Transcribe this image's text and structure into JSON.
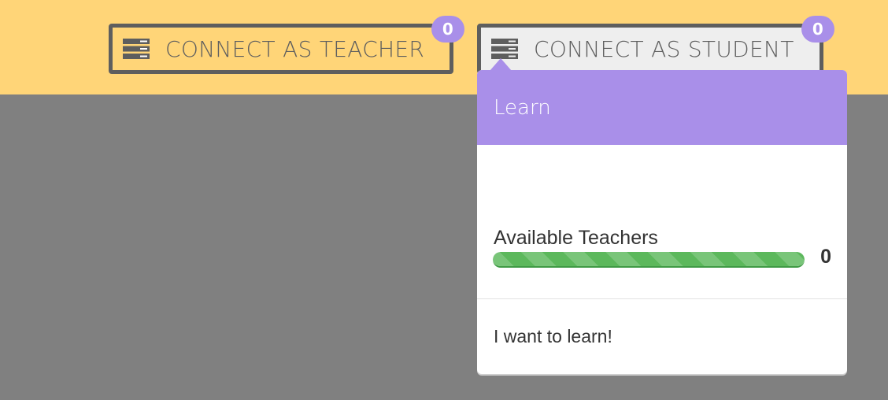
{
  "topbar": {
    "teacher_button": {
      "label": "CONNECT AS TEACHER",
      "badge": "0",
      "icon": "server-icon"
    },
    "student_button": {
      "label": "CONNECT AS STUDENT",
      "badge": "0",
      "icon": "server-icon"
    }
  },
  "popover": {
    "title": "Learn",
    "available_label": "Available Teachers",
    "available_count": "0",
    "progress_fraction": 1.0,
    "action_label": "I want to learn!"
  },
  "colors": {
    "topbar_bg": "#ffd578",
    "backdrop": "#808080",
    "accent_purple": "#a98fe9",
    "progress_green": "#5cb85c",
    "button_border": "#5e5e5e"
  }
}
